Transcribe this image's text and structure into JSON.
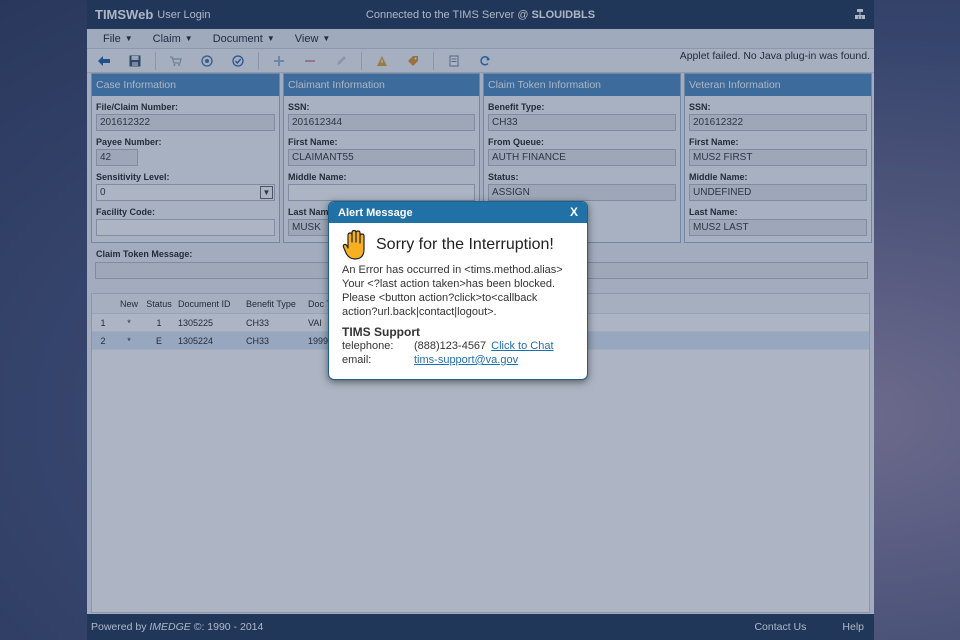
{
  "titlebar": {
    "brand": "TIMSWeb",
    "subtitle": "User Login",
    "server_prefix": "Connected to the TIMS Server @ ",
    "server_name": "SLOUIDBLS"
  },
  "menu": [
    {
      "label": "File"
    },
    {
      "label": "Claim"
    },
    {
      "label": "Document"
    },
    {
      "label": "View"
    }
  ],
  "toolbar": {
    "applet_message": "Applet failed. No Java plug-in was found."
  },
  "panels": {
    "case": {
      "title": "Case Information",
      "file_claim_label": "File/Claim Number:",
      "file_claim_value": "201612322",
      "payee_label": "Payee Number:",
      "payee_value": "42",
      "sensitivity_label": "Sensitivity Level:",
      "sensitivity_value": "0",
      "facility_label": "Facility Code:",
      "facility_value": ""
    },
    "claimant": {
      "title": "Claimant Information",
      "ssn_label": "SSN:",
      "ssn_value": "201612344",
      "first_label": "First Name:",
      "first_value": "CLAIMANT55",
      "middle_label": "Middle Name:",
      "middle_value": "",
      "last_label": "Last Name:",
      "last_value": "MUSK"
    },
    "token": {
      "title": "Claim Token Information",
      "benefit_label": "Benefit Type:",
      "benefit_value": "CH33",
      "queue_label": "From Queue:",
      "queue_value": "AUTH FINANCE",
      "status_label": "Status:",
      "status_value": "ASSIGN"
    },
    "veteran": {
      "title": "Veteran Information",
      "ssn_label": "SSN:",
      "ssn_value": "201612322",
      "first_label": "First Name:",
      "first_value": "MUS2 FIRST",
      "middle_label": "Middle Name:",
      "middle_value": "UNDEFINED",
      "last_label": "Last Name:",
      "last_value": "MUS2 LAST"
    }
  },
  "claim_token_message_label": "Claim Token Message:",
  "grid": {
    "headers": [
      "New",
      "Status",
      "Document ID",
      "Benefit Type",
      "Doc T"
    ],
    "rows": [
      {
        "num": "1",
        "new": "*",
        "status": "1",
        "doc_id": "1305225",
        "benefit": "CH33",
        "doct": "VAI"
      },
      {
        "num": "2",
        "new": "*",
        "status": "E",
        "doc_id": "1305224",
        "benefit": "CH33",
        "doct": "1999"
      }
    ]
  },
  "footer": {
    "powered": "Powered by ",
    "company": "IMEDGE",
    "copyright": " ©: 1990 - 2014",
    "contact": "Contact Us",
    "help": "Help"
  },
  "dialog": {
    "header": "Alert Message",
    "close": "X",
    "title": "Sorry for the Interruption!",
    "message": "An Error has occurred in <tims.method.alias>\nYour <?last action taken>has been blocked.\nPlease <button action?click>to<callback\naction?url.back|contact|logout>.",
    "support_title": "TIMS Support",
    "telephone_label": "telephone:",
    "telephone_value": "(888)123-4567",
    "chat_link": "Click to Chat",
    "email_label": "email:",
    "email_value": "tims-support@va.gov"
  },
  "colors": {
    "brand_navy": "#1c3454",
    "panel_header": "#4b88bd",
    "dialog_header": "#1f71a6",
    "link": "#1f6fb0"
  }
}
